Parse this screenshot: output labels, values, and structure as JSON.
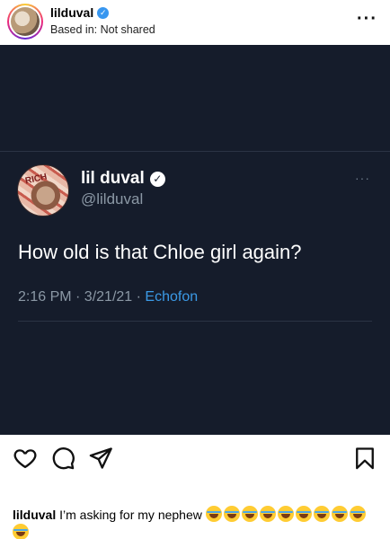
{
  "header": {
    "username": "lilduval",
    "location": "Based in: Not shared",
    "more_icon": "more-dots-icon"
  },
  "tweet": {
    "name": "lil duval",
    "handle": "@lilduval",
    "text": "How old is that Chloe girl again?",
    "time": "2:16 PM · 3/21/21 · ",
    "source": "Echofon",
    "avatar_text": "RICH"
  },
  "actions": {
    "like_icon": "heart-icon",
    "comment_icon": "comment-icon",
    "share_icon": "send-icon",
    "save_icon": "bookmark-icon"
  },
  "caption": {
    "username": "lilduval",
    "text": "I’m asking for my nephew",
    "emoji_count": 10,
    "emoji_name": "face-with-tears-of-joy"
  },
  "colors": {
    "post_bg": "#151c2b",
    "verified": "#3897f0",
    "link": "#3b9ae6"
  }
}
